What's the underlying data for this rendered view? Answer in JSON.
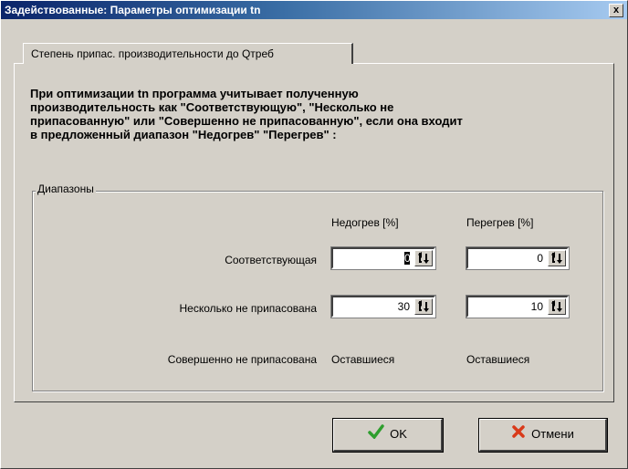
{
  "window": {
    "title": "Задействованные: Параметры оптимизации tn",
    "close_label": "x"
  },
  "tab": {
    "label": "Степень припас. производительности до Qтреб"
  },
  "description": "При оптимизации tn программа учитывает полученную\nпроизводительность как \"Соответствующую\", \"Несколько не\nприпасованную\" или \"Совершенно не припасованную\", если она входит\nв предложенный диапазон \"Недогрев\" \"Перегрев\" :",
  "ranges": {
    "legend": "Диапазоны",
    "col_underheat": "Недогрев [%]",
    "col_overheat": "Перегрев [%]",
    "rows": [
      {
        "label": "Соответствующая",
        "underheat": "0",
        "overheat": "0"
      },
      {
        "label": "Несколько не припасована",
        "underheat": "30",
        "overheat": "10"
      },
      {
        "label": "Совершенно не припасована",
        "underheat": "Оставшиеся",
        "overheat": "Оставшиеся"
      }
    ]
  },
  "buttons": {
    "ok_label": "OK",
    "cancel_label": "Отмени"
  },
  "colors": {
    "title_bar": "#0a246a",
    "ok_icon": "#2e9e2e",
    "cancel_icon": "#d93a1a"
  }
}
